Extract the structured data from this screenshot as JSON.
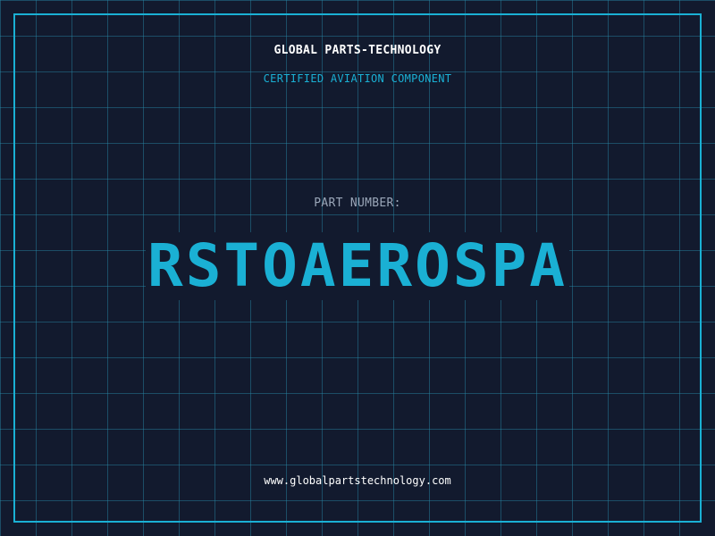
{
  "header": {
    "company": "GLOBAL PARTS-TECHNOLOGY",
    "subtitle": "CERTIFIED AVIATION COMPONENT"
  },
  "part": {
    "label": "PART NUMBER:",
    "number": "RSTOAEROSPA"
  },
  "footer": {
    "url": "www.globalpartstechnology.com"
  },
  "colors": {
    "background": "#121a2e",
    "accent": "#1ab0d4",
    "grid": "#288caa",
    "label": "#9aa6b8",
    "text": "#ffffff"
  }
}
